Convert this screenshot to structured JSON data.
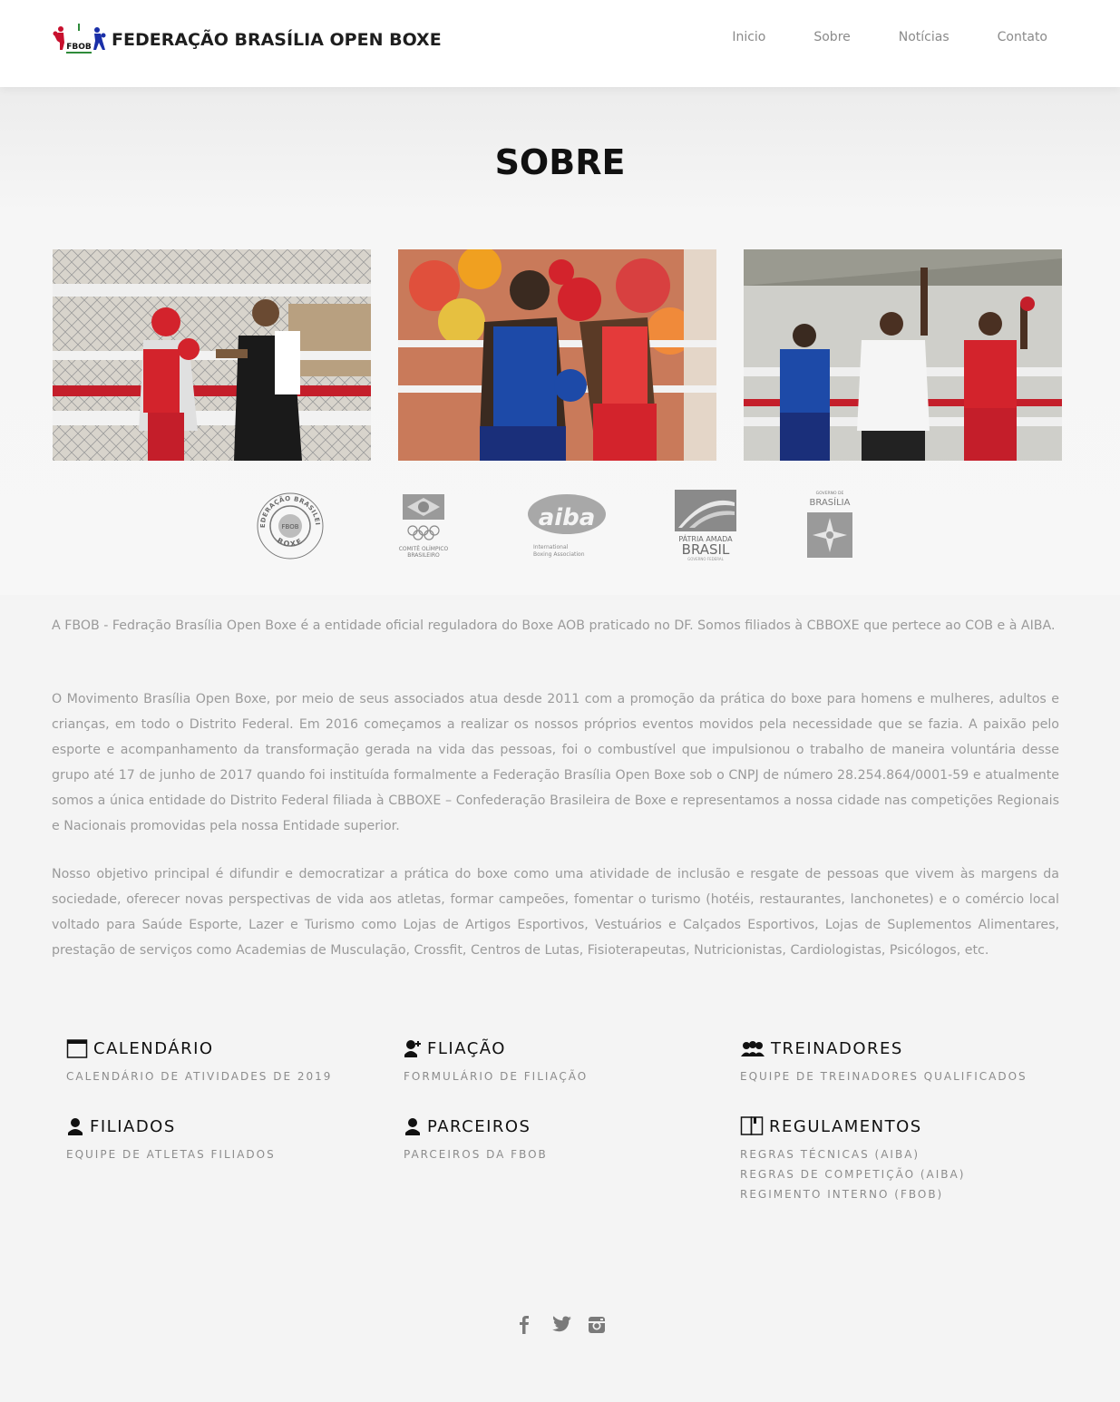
{
  "header": {
    "brand_name": "FEDERAÇÃO BRASÍLIA OPEN BOXE",
    "logo_text": "FBOB",
    "nav": [
      {
        "label": "Inicio"
      },
      {
        "label": "Sobre"
      },
      {
        "label": "Notícias"
      },
      {
        "label": "Contato"
      }
    ]
  },
  "page_title": "SOBRE",
  "photos": [
    {
      "icon": "boxing-photo-1"
    },
    {
      "icon": "boxing-photo-2"
    },
    {
      "icon": "boxing-photo-3"
    }
  ],
  "partner_logos": [
    {
      "name": "cbboxe-logo",
      "text_top": "CONFEDERAÇÃO BRASILEIRA DE",
      "text_bottom": "BOXE",
      "center": "FBOB"
    },
    {
      "name": "cob-logo",
      "line1": "COMITÊ OLÍMPICO",
      "line2": "BRASILEIRO"
    },
    {
      "name": "aiba-logo",
      "word": "aiba",
      "line1": "International",
      "line2": "Boxing Association"
    },
    {
      "name": "brasil-gov-logo",
      "line1": "PÁTRIA AMADA",
      "line2": "BRASIL",
      "line3": "GOVERNO FEDERAL"
    },
    {
      "name": "gdf-logo",
      "line1": "GOVERNO DE",
      "line2": "BRASÍLIA"
    }
  ],
  "content": {
    "p1": "A FBOB - Fedração Brasília Open Boxe é a entidade oficial reguladora do Boxe AOB praticado no DF. Somos filiados à CBBOXE que pertece ao COB e à AIBA.",
    "p2": "O Movimento Brasília Open Boxe, por meio de seus associados atua desde 2011 com a promoção da prática do boxe para homens e mulheres, adultos e crianças, em todo o Distrito Federal. Em 2016 começamos a realizar os nossos próprios eventos movidos pela necessidade que se fazia. A paixão pelo esporte e acompanhamento da transformação gerada na vida das pessoas, foi o combustível que impulsionou o trabalho de maneira voluntária desse grupo até 17 de junho de 2017 quando foi instituída formalmente a Federação Brasília Open Boxe sob o CNPJ de número 28.254.864/0001-59 e atualmente somos a única entidade do Distrito Federal filiada à CBBOXE – Confederação Brasileira de Boxe e representamos a nossa cidade nas competições Regionais e Nacionais promovidas pela nossa Entidade superior.",
    "p3": "Nosso objetivo principal é difundir e democratizar a prática do boxe como uma atividade de inclusão e resgate de pessoas que vivem às margens da sociedade, oferecer novas perspectivas de vida aos atletas, formar campeões, fomentar o turismo (hotéis, restaurantes, lanchonetes) e o comércio local voltado para Saúde Esporte, Lazer e Turismo como Lojas de Artigos Esportivos, Vestuários e Calçados Esportivos, Lojas de Suplementos Alimentares, prestação de serviços como Academias de Musculação, Crossfit, Centros de Lutas, Fisioterapeutas, Nutricionistas, Cardiologistas, Psicólogos, etc."
  },
  "features": [
    {
      "icon": "calendar-icon",
      "title": "CALENDÁRIO",
      "links": [
        "CALENDÁRIO DE ATIVIDADES DE 2019"
      ]
    },
    {
      "icon": "user-add-icon",
      "title": "FLIAÇÃO",
      "links": [
        "FORMULÁRIO DE FILIAÇÃO"
      ]
    },
    {
      "icon": "users-icon",
      "title": "TREINADORES",
      "links": [
        "EQUIPE DE TREINADORES QUALIFICADOS"
      ]
    },
    {
      "icon": "user-icon",
      "title": "FILIADOS",
      "links": [
        "EQUIPE DE ATLETAS FILIADOS"
      ]
    },
    {
      "icon": "user-icon",
      "title": "PARCEIROS",
      "links": [
        "PARCEIROS DA FBOB"
      ]
    },
    {
      "icon": "book-icon",
      "title": "REGULAMENTOS",
      "links": [
        "REGRAS TÉCNICAS (AIBA)",
        "REGRAS DE COMPETIÇÃO (AIBA)",
        "REGIMENTO INTERNO (FBOB)"
      ]
    }
  ],
  "social": [
    {
      "icon": "facebook-icon"
    },
    {
      "icon": "twitter-icon"
    },
    {
      "icon": "instagram-icon"
    }
  ],
  "colors": {
    "background": "#f4f4f4",
    "header_bg": "#ffffff",
    "nav_text": "#8a8a8a",
    "body_text": "#9a9a9a",
    "heading": "#111111"
  }
}
